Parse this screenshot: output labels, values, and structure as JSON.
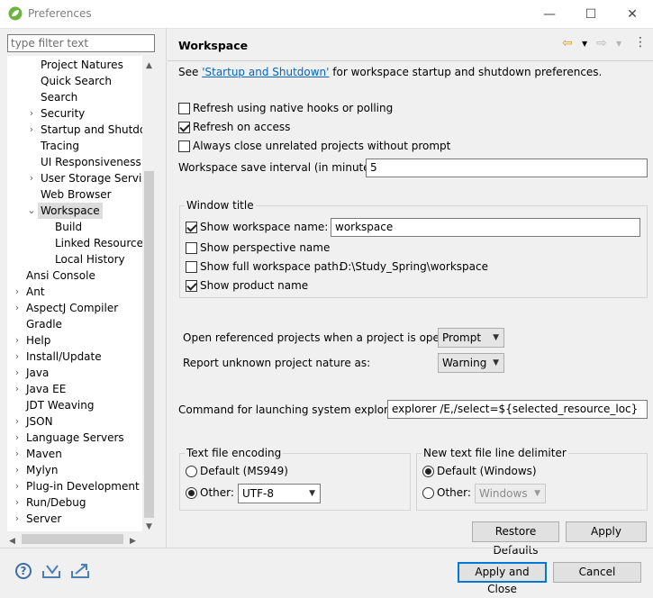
{
  "window": {
    "title": "Preferences",
    "minimize": "—",
    "maximize": "☐",
    "close": "✕"
  },
  "filter": {
    "placeholder": "type filter text"
  },
  "tree": [
    {
      "label": "Project Natures",
      "expander": ""
    },
    {
      "label": "Quick Search",
      "expander": ""
    },
    {
      "label": "Search",
      "expander": ""
    },
    {
      "label": "Security",
      "expander": "›"
    },
    {
      "label": "Startup and Shutdow",
      "expander": "›"
    },
    {
      "label": "Tracing",
      "expander": ""
    },
    {
      "label": "UI Responsiveness M",
      "expander": ""
    },
    {
      "label": "User Storage Service",
      "expander": "›"
    },
    {
      "label": "Web Browser",
      "expander": ""
    },
    {
      "label": "Workspace",
      "expander": "⌄",
      "selected": true
    },
    {
      "label": "Build",
      "expander": ""
    },
    {
      "label": "Linked Resources",
      "expander": ""
    },
    {
      "label": "Local History",
      "expander": ""
    },
    {
      "label": "Ansi Console",
      "expander": ""
    },
    {
      "label": "Ant",
      "expander": "›"
    },
    {
      "label": "AspectJ Compiler",
      "expander": "›"
    },
    {
      "label": "Gradle",
      "expander": ""
    },
    {
      "label": "Help",
      "expander": "›"
    },
    {
      "label": "Install/Update",
      "expander": "›"
    },
    {
      "label": "Java",
      "expander": "›"
    },
    {
      "label": "Java EE",
      "expander": "›"
    },
    {
      "label": "JDT Weaving",
      "expander": ""
    },
    {
      "label": "JSON",
      "expander": "›"
    },
    {
      "label": "Language Servers",
      "expander": "›"
    },
    {
      "label": "Maven",
      "expander": "›"
    },
    {
      "label": "Mylyn",
      "expander": "›"
    },
    {
      "label": "Plug-in Development",
      "expander": "›"
    },
    {
      "label": "Run/Debug",
      "expander": "›"
    },
    {
      "label": "Server",
      "expander": "›"
    }
  ],
  "page": {
    "title": "Workspace",
    "see_prefix": "See ",
    "see_link": "'Startup and Shutdown'",
    "see_suffix": " for workspace startup and shutdown preferences.",
    "refresh_native": "Refresh using native hooks or polling",
    "refresh_access": "Refresh on access",
    "always_close": "Always close unrelated projects without prompt",
    "save_interval_label": "Workspace save interval (in minutes):",
    "save_interval_value": "5",
    "window_title_group": "Window title",
    "show_ws_name": "Show workspace name:",
    "ws_name_value": "workspace",
    "show_perspective": "Show perspective name",
    "show_full_path": "Show full workspace path:",
    "full_path_value": "D:\\Study_Spring\\workspace",
    "show_product": "Show product name",
    "open_ref_label": "Open referenced projects when a project is opened:",
    "open_ref_value": "Prompt",
    "unknown_nature_label": "Report unknown project nature as:",
    "unknown_nature_value": "Warning",
    "cmd_label": "Command for launching system explorer:",
    "cmd_value": "explorer /E,/select=${selected_resource_loc}",
    "encoding_group": "Text file encoding",
    "enc_default": "Default (MS949)",
    "enc_other": "Other:",
    "enc_other_value": "UTF-8",
    "delim_group": "New text file line delimiter",
    "delim_default": "Default (Windows)",
    "delim_other": "Other:",
    "delim_other_value": "Windows",
    "restore_defaults": "Restore Defaults",
    "apply": "Apply"
  },
  "footer": {
    "apply_close": "Apply and Close",
    "cancel": "Cancel",
    "help_icon_glyph": "?"
  },
  "colors": {
    "link": "#0066cc",
    "selection": "#dcdcdc",
    "default_button_border": "#0078d7"
  }
}
